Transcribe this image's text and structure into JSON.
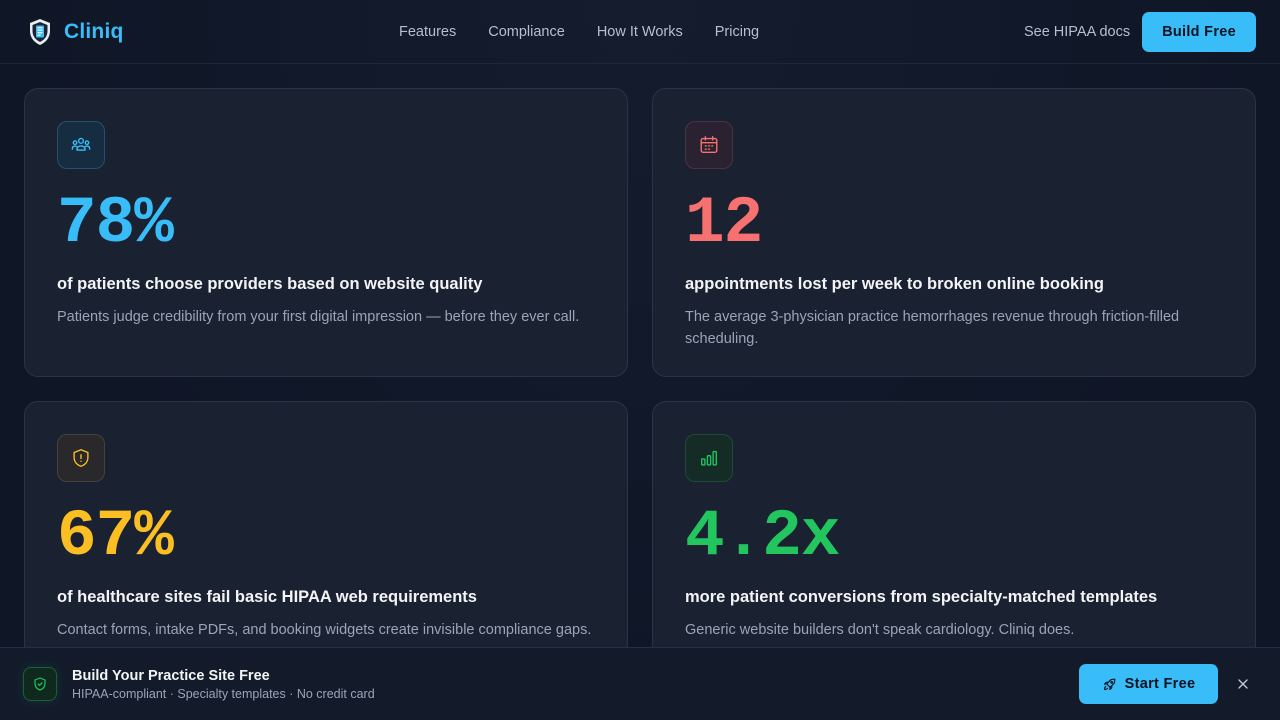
{
  "brand": {
    "name": "Cliniq",
    "logo_icon": "shield-logo-icon"
  },
  "nav": [
    {
      "label": "Features"
    },
    {
      "label": "Compliance"
    },
    {
      "label": "How It Works"
    },
    {
      "label": "Pricing"
    }
  ],
  "header": {
    "docs_label": "See HIPAA docs",
    "cta_label": "Build Free"
  },
  "cards": [
    {
      "icon": "patients-group-icon",
      "color": "#38bdf8",
      "stat": "78%",
      "title": "of patients choose providers based on website quality",
      "desc": "Patients judge credibility from your first digital impression — before they ever call."
    },
    {
      "icon": "calendar-icon",
      "color": "#f87171",
      "stat": "12",
      "title": "appointments lost per week to broken online booking",
      "desc": "The average 3-physician practice hemorrhages revenue through friction-filled scheduling."
    },
    {
      "icon": "shield-alert-icon",
      "color": "#fbbf24",
      "stat": "67%",
      "title": "of healthcare sites fail basic HIPAA web requirements",
      "desc": "Contact forms, intake PDFs, and booking widgets create invisible compliance gaps."
    },
    {
      "icon": "bar-chart-icon",
      "color": "#22c55e",
      "stat": "4.2x",
      "title": "more patient conversions from specialty-matched templates",
      "desc": "Generic website builders don't speak cardiology. Cliniq does."
    }
  ],
  "bottom_bar": {
    "icon": "shield-check-icon",
    "title": "Build Your Practice Site Free",
    "subtitle": "HIPAA-compliant · Specialty templates · No credit card",
    "cta_label": "Start Free",
    "cta_icon": "rocket-icon",
    "close_icon": "close-icon"
  }
}
